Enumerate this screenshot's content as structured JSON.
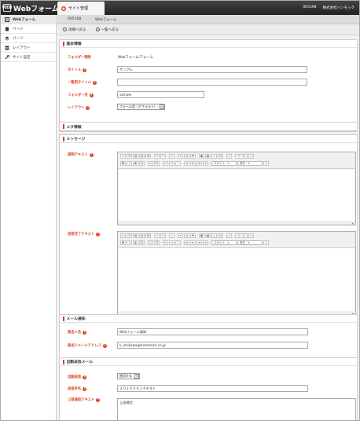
{
  "app": {
    "title": "Webフォーム",
    "logo_mark": "WEB",
    "site_tab": "サイト管理",
    "company_id": "005398",
    "company_name": "株式会社ハンモック"
  },
  "sidebar": {
    "items": [
      {
        "label": "Webフォーム",
        "icon": "form-icon",
        "active": true
      },
      {
        "label": "ページ",
        "icon": "page-icon"
      },
      {
        "label": "パーツ",
        "icon": "parts-icon"
      },
      {
        "label": "レイアウト",
        "icon": "layout-icon"
      },
      {
        "label": "サイト設定",
        "icon": "wrench-icon"
      }
    ]
  },
  "subhead": {
    "id": "005108",
    "name": "Webフォーム"
  },
  "actions": {
    "detail": "詳細へ戻る",
    "list": "一覧へ戻る"
  },
  "basic": {
    "title": "基本情報",
    "folder_path_label": "フォルダー階性",
    "folder_path_value": "Webフォーム/フォーム",
    "title_label": "タイトル",
    "title_value": "サンプル",
    "list_title_label": "一覧用タイトル",
    "list_title_value": "",
    "folder_name_label": "フォルダー名",
    "folder_name_value": "sample",
    "layout_label": "レイアウト",
    "layout_value": "フォーム用（デフォルト）"
  },
  "meta": {
    "title": "メタ情報"
  },
  "message": {
    "title": "メッセージ",
    "description_label": "説明テキスト",
    "complete_label": "送信完了テキスト",
    "toolbar": {
      "source": "ソース",
      "style": "スタイル",
      "format": "書式",
      "help": "?"
    }
  },
  "mail": {
    "title": "メール通知",
    "sender_name_label": "差出人名",
    "sender_name_value": "Webフォーム通知",
    "sender_email_label": "差出人メールアドレス",
    "sender_email_value": "k_ishikawa@hammock.co.jp"
  },
  "auto_reply": {
    "title": "自動返信メール",
    "enabled_label": "自動返信",
    "enabled_value": "使用する",
    "subject_label": "返信件名",
    "subject_value": "２０１６０８１４テスト",
    "upper_text_label": "上部通信テキスト",
    "upper_text_value": "上部通信"
  },
  "colors": {
    "accent": "#d9421b",
    "topbar": "#2b2b2b"
  }
}
